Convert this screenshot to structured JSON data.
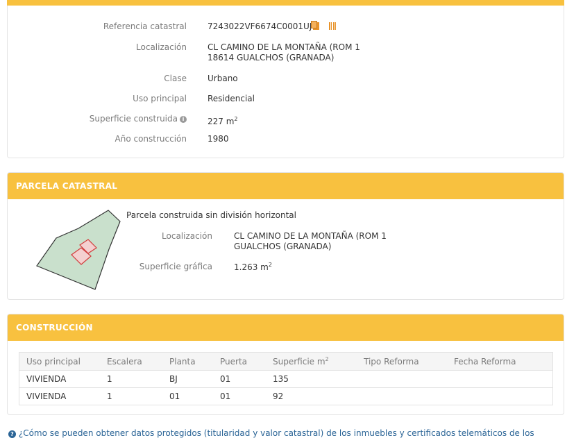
{
  "inmueble": {
    "rows": [
      {
        "label": "Referencia catastral",
        "value": "7243022VF6674C0001UJ"
      },
      {
        "label": "Localización",
        "value": "CL CAMINO DE LA MONTAÑA (ROM 1",
        "value2": "18614 GUALCHOS (GRANADA)"
      },
      {
        "label": "Clase",
        "value": "Urbano"
      },
      {
        "label": "Uso principal",
        "value": "Residencial"
      },
      {
        "label": "Superficie construida",
        "value": "227 m",
        "sup": "2"
      },
      {
        "label": "Año construcción",
        "value": "1980"
      }
    ]
  },
  "parcela": {
    "title": "PARCELA CATASTRAL",
    "subtitle": "Parcela construida sin división horizontal",
    "loc_label": "Localización",
    "loc_value1": "CL CAMINO DE LA MONTAÑA (ROM 1",
    "loc_value2": "GUALCHOS (GRANADA)",
    "sup_label": "Superficie gráfica",
    "sup_value": "1.263 m",
    "sup_exp": "2"
  },
  "construccion": {
    "title": "CONSTRUCCIÓN",
    "headers": [
      "Uso principal",
      "Escalera",
      "Planta",
      "Puerta",
      "Superficie m",
      "Tipo Reforma",
      "Fecha Reforma"
    ],
    "header_sup": "2",
    "rows": [
      [
        "VIVIENDA",
        "1",
        "BJ",
        "01",
        "135",
        "",
        ""
      ],
      [
        "VIVIENDA",
        "1",
        "01",
        "01",
        "92",
        "",
        ""
      ]
    ]
  },
  "footer": {
    "text": "¿Cómo se pueden obtener datos protegidos (titularidad y valor catastral) de los inmuebles y certificados telemáticos de los"
  },
  "colors": {
    "header": "#f8c13f",
    "link": "#2a6496",
    "parcel_fill": "#c9e0cc"
  }
}
